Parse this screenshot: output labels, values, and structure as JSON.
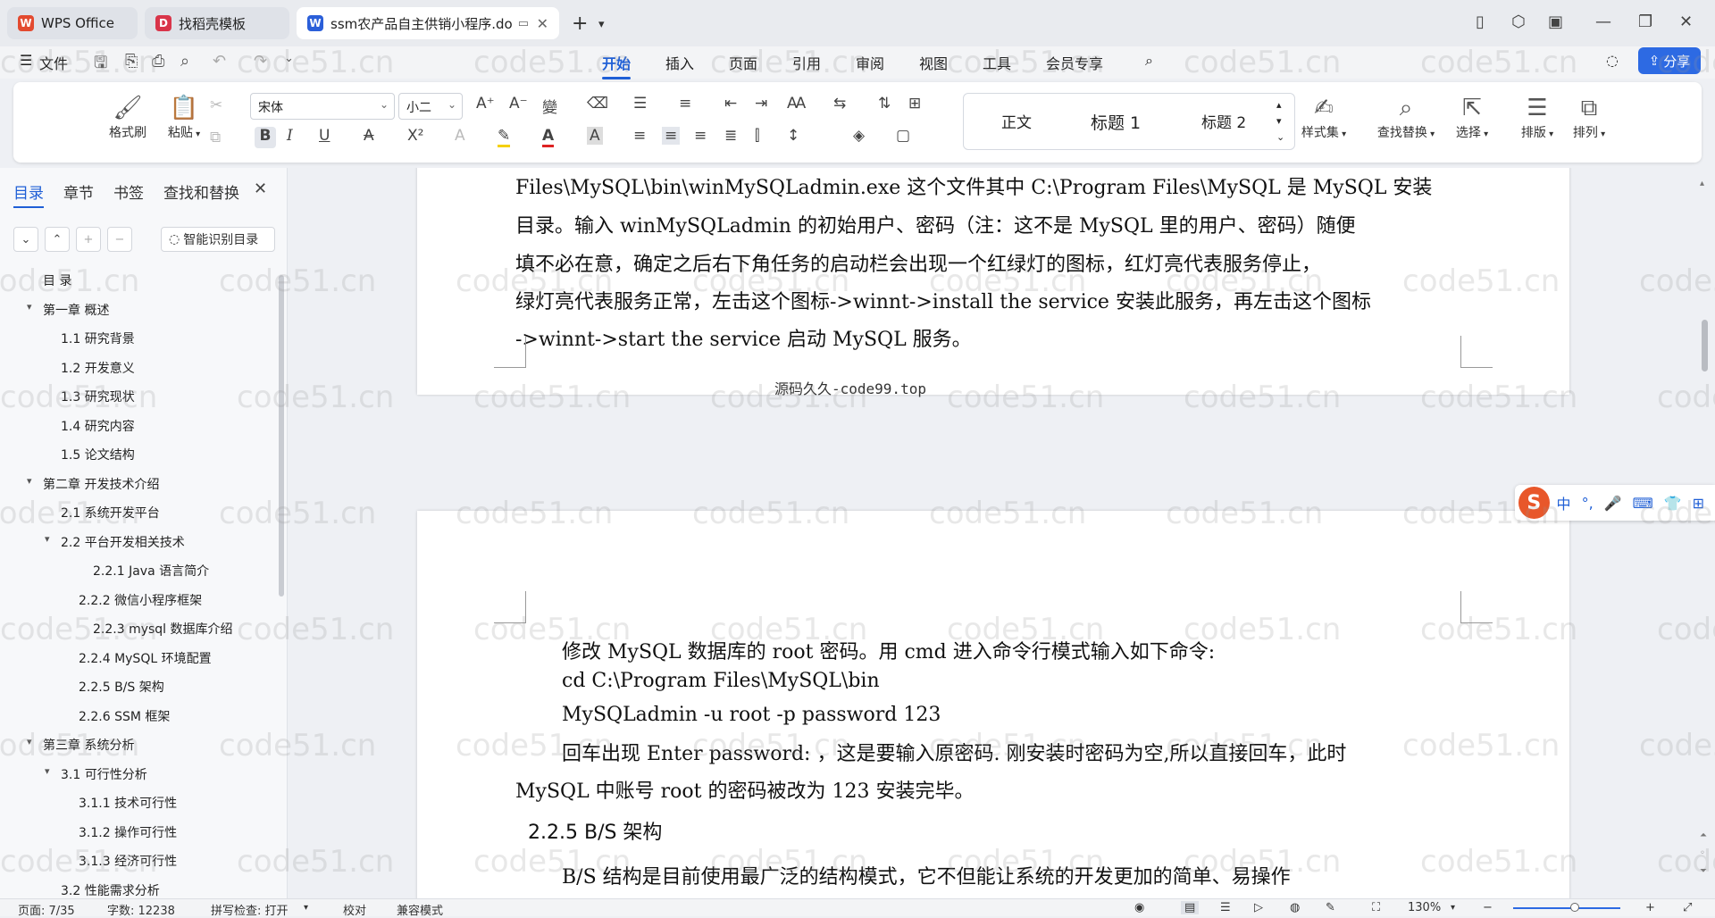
{
  "tabs": [
    {
      "label": "WPS Office",
      "icon": "wps-logo-icon",
      "color": "#e34a2f"
    },
    {
      "label": "找稻壳模板",
      "icon": "docer-icon",
      "color": "#d9354a"
    },
    {
      "label": "ssm农产品自主供销小程序.do",
      "icon": "word-doc-icon",
      "color": "#2b5fd9"
    }
  ],
  "menu": {
    "file": "文件",
    "items": [
      "开始",
      "插入",
      "页面",
      "引用",
      "审阅",
      "视图",
      "工具",
      "会员专享"
    ],
    "active": "开始",
    "share": "分享"
  },
  "ribbon": {
    "format_painter": "格式刷",
    "paste": "粘贴",
    "font_name": "宋体",
    "font_size": "小二",
    "styles": [
      "正文",
      "标题 1",
      "标题 2"
    ],
    "style_set": "样式集",
    "find_replace": "查找替换",
    "select": "选择",
    "layout": "排版",
    "arrange": "排列",
    "accent": "#1f5fd6"
  },
  "sidebar": {
    "tabs": [
      "目录",
      "章节",
      "书签",
      "查找和替换"
    ],
    "smart_toc": "智能识别目录",
    "toc": [
      {
        "label": "目  录",
        "level": 0
      },
      {
        "label": "第一章 概述",
        "level": 0,
        "expanded": true
      },
      {
        "label": "1.1 研究背景",
        "level": 1
      },
      {
        "label": "1.2 开发意义",
        "level": 1
      },
      {
        "label": "1.3 研究现状",
        "level": 1
      },
      {
        "label": "1.4 研究内容",
        "level": 1
      },
      {
        "label": "1.5 论文结构",
        "level": 1
      },
      {
        "label": "第二章 开发技术介绍",
        "level": 0,
        "expanded": true
      },
      {
        "label": "2.1 系统开发平台",
        "level": 1
      },
      {
        "label": "2.2 平台开发相关技术",
        "level": 1,
        "expanded": true
      },
      {
        "label": "2.2.1   Java 语言简介",
        "level": 3
      },
      {
        "label": "2.2.2   微信小程序框架",
        "level": 2
      },
      {
        "label": "2.2.3   mysql 数据库介绍",
        "level": 3
      },
      {
        "label": "2.2.4   MySQL 环境配置",
        "level": 2
      },
      {
        "label": "2.2.5   B/S 架构",
        "level": 2
      },
      {
        "label": "2.2.6   SSM 框架",
        "level": 2
      },
      {
        "label": "第三章 系统分析",
        "level": 0,
        "expanded": true
      },
      {
        "label": "3.1 可行性分析",
        "level": 1,
        "expanded": true
      },
      {
        "label": "3.1.1 技术可行性",
        "level": 2
      },
      {
        "label": "3.1.2 操作可行性",
        "level": 2
      },
      {
        "label": "3.1.3 经济可行性",
        "level": 2
      },
      {
        "label": "3.2 性能需求分析",
        "level": 1
      }
    ]
  },
  "document": {
    "page1_lines": [
      "Files\\MySQL\\bin\\winMySQLadmin.exe 这个文件其中 C:\\Program Files\\MySQL 是 MySQL 安装",
      "目录。输入 winMySQLadmin 的初始用户、密码（注：这不是 MySQL 里的用户、密码）随便",
      "填不必在意，确定之后右下角任务的启动栏会出现一个红绿灯的图标，红灯亮代表服务停止，",
      "绿灯亮代表服务正常，左击这个图标->winnt->install the service  安装此服务，再左击这个图标",
      "->winnt->start the service  启动 MySQL 服务。"
    ],
    "page1_footer": "源码久久-code99.top",
    "page2_lines": [
      "修改 MySQL 数据库的 root 密码。用 cmd 进入命令行模式输入如下命令:",
      "cd C:\\Program Files\\MySQL\\bin",
      "MySQLadmin -u root -p password 123",
      "回车出现 Enter password: ，这是要输入原密码. 刚安装时密码为空,所以直接回车，此时",
      "MySQL  中账号  root  的密码被改为  123  安装完毕。"
    ],
    "heading": "2.2.5   B/S 架构",
    "next_line": "B/S 结构是目前使用最广泛的结构模式，它不但能让系统的开发更加的简单、易操作"
  },
  "ime": {
    "lang": "中"
  },
  "watermark": "code51.cn",
  "status": {
    "page": "页面: 7/35",
    "words": "字数: 12238",
    "spell": "拼写检查: 打开",
    "proof": "校对",
    "compat": "兼容模式",
    "zoom": "130%"
  }
}
